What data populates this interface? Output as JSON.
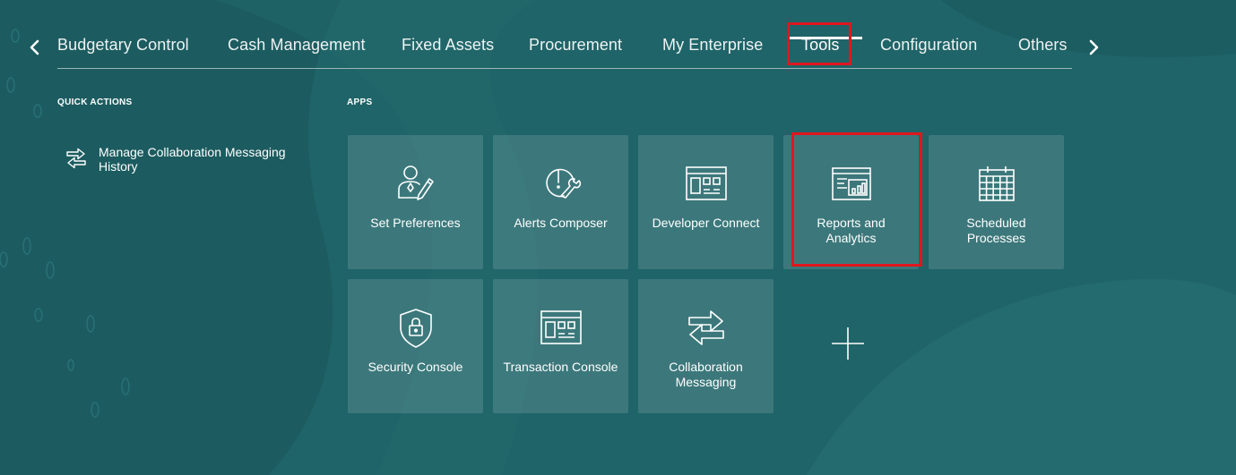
{
  "nav": {
    "tabs": [
      {
        "label": "Budgetary Control"
      },
      {
        "label": "Cash Management"
      },
      {
        "label": "Fixed Assets"
      },
      {
        "label": "Procurement"
      },
      {
        "label": "My Enterprise"
      },
      {
        "label": "Tools",
        "active": true
      },
      {
        "label": "Configuration"
      },
      {
        "label": "Others"
      }
    ],
    "prev_icon": "chevron-left-icon",
    "next_icon": "chevron-right-icon"
  },
  "quick_actions": {
    "header": "QUICK ACTIONS",
    "items": [
      {
        "label": "Manage Collaboration Messaging History",
        "icon": "arrows-exchange-icon"
      }
    ]
  },
  "apps": {
    "header": "APPS",
    "tiles": [
      {
        "label": "Set Preferences",
        "icon": "user-edit-icon"
      },
      {
        "label": "Alerts Composer",
        "icon": "alert-wrench-icon"
      },
      {
        "label": "Developer Connect",
        "icon": "window-panels-icon"
      },
      {
        "label": "Reports and Analytics",
        "icon": "report-chart-icon"
      },
      {
        "label": "Scheduled Processes",
        "icon": "calendar-icon"
      },
      {
        "label": "Security Console",
        "icon": "shield-lock-icon"
      },
      {
        "label": "Transaction Console",
        "icon": "window-panels-icon"
      },
      {
        "label": "Collaboration Messaging",
        "icon": "arrows-exchange-icon"
      }
    ],
    "add_icon": "plus-icon"
  },
  "colors": {
    "background": "#1f6468",
    "highlight": "#e0161f",
    "tile": "rgba(255,255,255,0.13)"
  }
}
